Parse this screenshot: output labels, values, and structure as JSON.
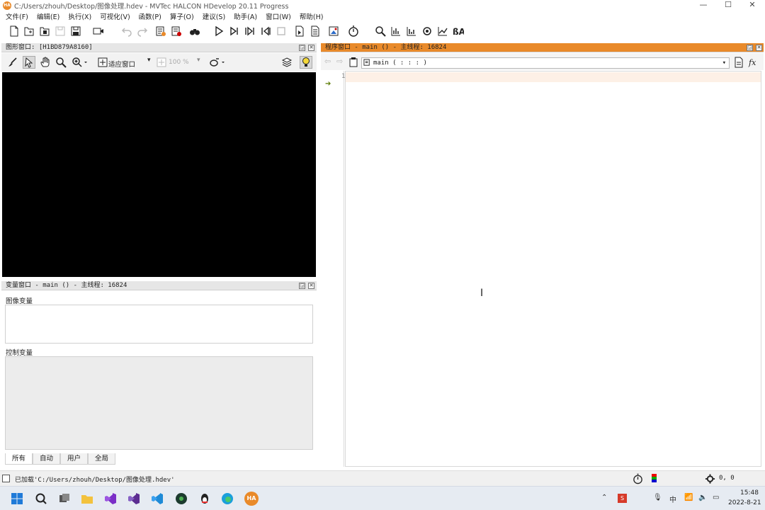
{
  "window": {
    "title": "C:/Users/zhouh/Desktop/图像处理.hdev - MVTec HALCON HDevelop 20.11 Progress",
    "logo_text": "HA",
    "minimize": "—",
    "maximize": "☐",
    "close": "✕"
  },
  "menu": [
    "文件(F)",
    "编辑(E)",
    "执行(X)",
    "可视化(V)",
    "函数(P)",
    "算子(O)",
    "建议(S)",
    "助手(A)",
    "窗口(W)",
    "帮助(H)"
  ],
  "graphics_window": {
    "title": "图形窗口: [H1BD879A8160]",
    "fit_label": "适应窗口",
    "zoom_value": "100 %"
  },
  "variable_window": {
    "title": "变量窗口 - main () - 主线程: 16824",
    "iconic_label": "图像变量",
    "control_label": "控制变量",
    "tabs": [
      "所有",
      "自动",
      "用户",
      "全局"
    ]
  },
  "program_window": {
    "title": "程序窗口 - main () - 主线程: 16824",
    "procedure": "main ( : : : )",
    "line_marker": "1"
  },
  "status": {
    "message": "已加载'C:/Users/zhouh/Desktop/图像处理.hdev'",
    "coords": "0, 0"
  },
  "taskbar": {
    "ime": "中",
    "time": "15:48",
    "date": "2022-8-21"
  },
  "colors": {
    "accent": "#e98a2a",
    "canvas": "#000000"
  }
}
